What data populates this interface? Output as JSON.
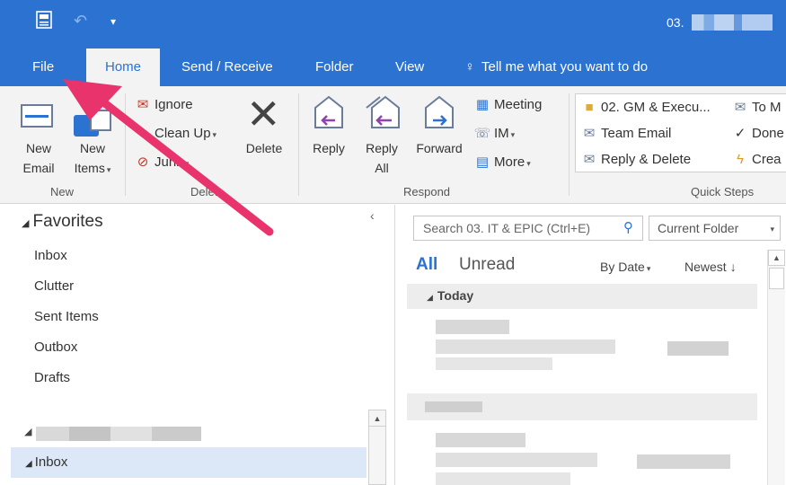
{
  "titlebar": {
    "title_prefix": "03."
  },
  "quick_access": {
    "save_icon": "save-icon",
    "undo_icon": "undo-icon",
    "customize_icon": "customize-icon"
  },
  "tabs": {
    "file": "File",
    "home": "Home",
    "send_receive": "Send / Receive",
    "folder": "Folder",
    "view": "View",
    "tell_me": "Tell me what you want to do"
  },
  "ribbon": {
    "new_group": {
      "label": "New",
      "new_email_line1": "New",
      "new_email_line2": "Email",
      "new_items_line1": "New",
      "new_items_line2": "Items"
    },
    "delete_group": {
      "label": "Delete",
      "ignore": "Ignore",
      "clean_up": "Clean Up",
      "junk": "Junk",
      "delete": "Delete"
    },
    "respond_group": {
      "label": "Respond",
      "reply": "Reply",
      "reply_all_line1": "Reply",
      "reply_all_line2": "All",
      "forward": "Forward",
      "meeting": "Meeting",
      "im": "IM",
      "more": "More"
    },
    "quick_steps": {
      "label": "Quick Steps",
      "step1": "02. GM & Execu...",
      "step2": "Team Email",
      "step3": "Reply & Delete",
      "step4": "To M",
      "step5": "Done",
      "step6": "Crea"
    }
  },
  "folder_pane": {
    "favorites": "Favorites",
    "items": [
      "Inbox",
      "Clutter",
      "Sent Items",
      "Outbox",
      "Drafts"
    ],
    "inbox": "Inbox"
  },
  "message_list": {
    "search_placeholder": "Search 03. IT & EPIC (Ctrl+E)",
    "scope": "Current Folder",
    "filter_all": "All",
    "filter_unread": "Unread",
    "sort_by": "By Date",
    "sort_order": "Newest",
    "today": "Today"
  },
  "colors": {
    "accent": "#2b72d1",
    "annotation_arrow": "#e8336d"
  }
}
